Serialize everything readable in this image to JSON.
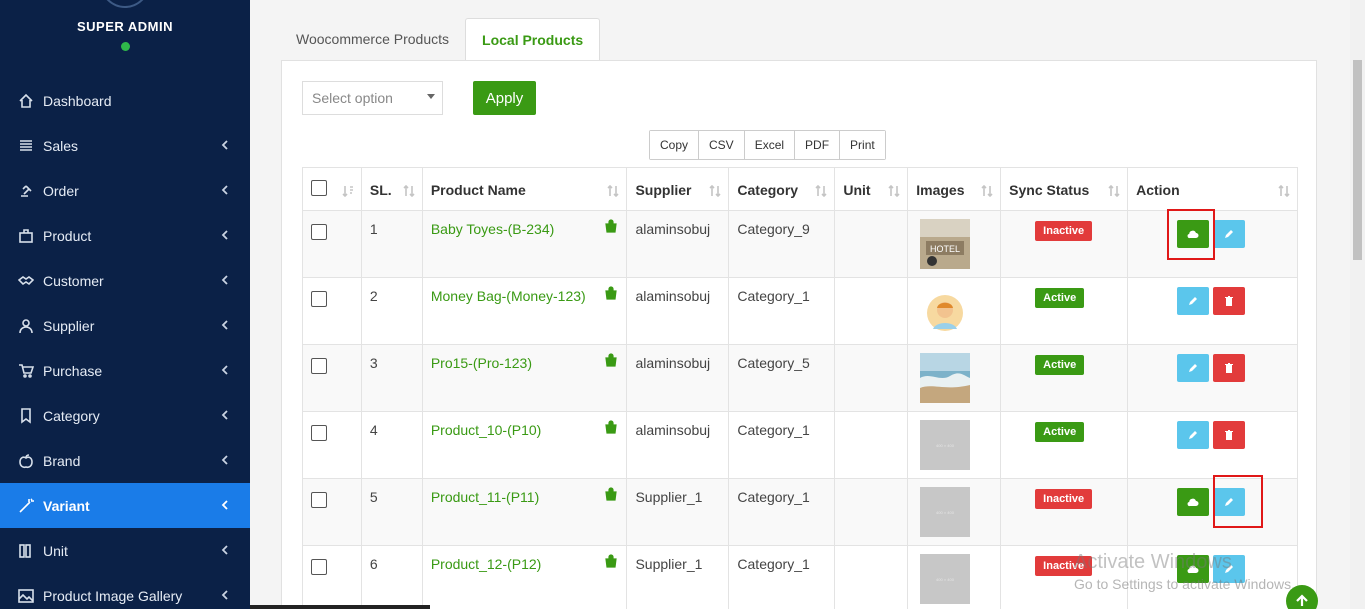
{
  "sidebar": {
    "admin_title": "SUPER ADMIN",
    "items": [
      {
        "label": "Dashboard",
        "icon": "home-icon",
        "has_chevron": false
      },
      {
        "label": "Sales",
        "icon": "list-icon",
        "has_chevron": true
      },
      {
        "label": "Order",
        "icon": "gavel-icon",
        "has_chevron": true
      },
      {
        "label": "Product",
        "icon": "briefcase-icon",
        "has_chevron": true
      },
      {
        "label": "Customer",
        "icon": "handshake-icon",
        "has_chevron": true
      },
      {
        "label": "Supplier",
        "icon": "user-icon",
        "has_chevron": true
      },
      {
        "label": "Purchase",
        "icon": "cart-icon",
        "has_chevron": true
      },
      {
        "label": "Category",
        "icon": "tag-icon",
        "has_chevron": true
      },
      {
        "label": "Brand",
        "icon": "apple-icon",
        "has_chevron": true
      },
      {
        "label": "Variant",
        "icon": "magic-wand-icon",
        "has_chevron": true,
        "active": true
      },
      {
        "label": "Unit",
        "icon": "columns-icon",
        "has_chevron": true
      },
      {
        "label": "Product Image Gallery",
        "icon": "image-icon",
        "has_chevron": true
      }
    ]
  },
  "tabs": [
    {
      "label": "Woocommerce Products",
      "active": false
    },
    {
      "label": "Local Products",
      "active": true
    }
  ],
  "bulk": {
    "select_placeholder": "Select option",
    "apply_label": "Apply"
  },
  "export_buttons": [
    "Copy",
    "CSV",
    "Excel",
    "PDF",
    "Print"
  ],
  "table": {
    "headers": [
      "SL.",
      "Product Name",
      "Supplier",
      "Category",
      "Unit",
      "Images",
      "Sync Status",
      "Action"
    ],
    "rows": [
      {
        "sl": "1",
        "name": "Baby Toyes-(B-234)",
        "supplier": "alaminsobuj",
        "category": "Category_9",
        "unit": "",
        "image": "hotel-photo",
        "status": "Inactive",
        "actions": [
          "sync",
          "edit"
        ]
      },
      {
        "sl": "2",
        "name": "Money Bag-(Money-123)",
        "supplier": "alaminsobuj",
        "category": "Category_1",
        "unit": "",
        "image": "avatar-illustration",
        "status": "Active",
        "actions": [
          "edit",
          "delete"
        ]
      },
      {
        "sl": "3",
        "name": "Pro15-(Pro-123)",
        "supplier": "alaminsobuj",
        "category": "Category_5",
        "unit": "",
        "image": "sea-wave-photo",
        "status": "Active",
        "actions": [
          "edit",
          "delete"
        ]
      },
      {
        "sl": "4",
        "name": "Product_10-(P10)",
        "supplier": "alaminsobuj",
        "category": "Category_1",
        "unit": "",
        "image": "placeholder",
        "status": "Active",
        "actions": [
          "edit",
          "delete"
        ]
      },
      {
        "sl": "5",
        "name": "Product_11-(P11)",
        "supplier": "Supplier_1",
        "category": "Category_1",
        "unit": "",
        "image": "placeholder",
        "status": "Inactive",
        "actions": [
          "sync",
          "edit"
        ]
      },
      {
        "sl": "6",
        "name": "Product_12-(P12)",
        "supplier": "Supplier_1",
        "category": "Category_1",
        "unit": "",
        "image": "placeholder",
        "status": "Inactive",
        "actions": [
          "sync",
          "edit"
        ]
      }
    ]
  },
  "watermark": {
    "line1": "Activate Windows",
    "line2": "Go to Settings to activate Windows."
  },
  "colors": {
    "sidebar_bg": "#0b2147",
    "active_item": "#1a7ce8",
    "brand_green": "#3a9a14",
    "danger": "#e23b3b",
    "info": "#5bc6ec"
  }
}
